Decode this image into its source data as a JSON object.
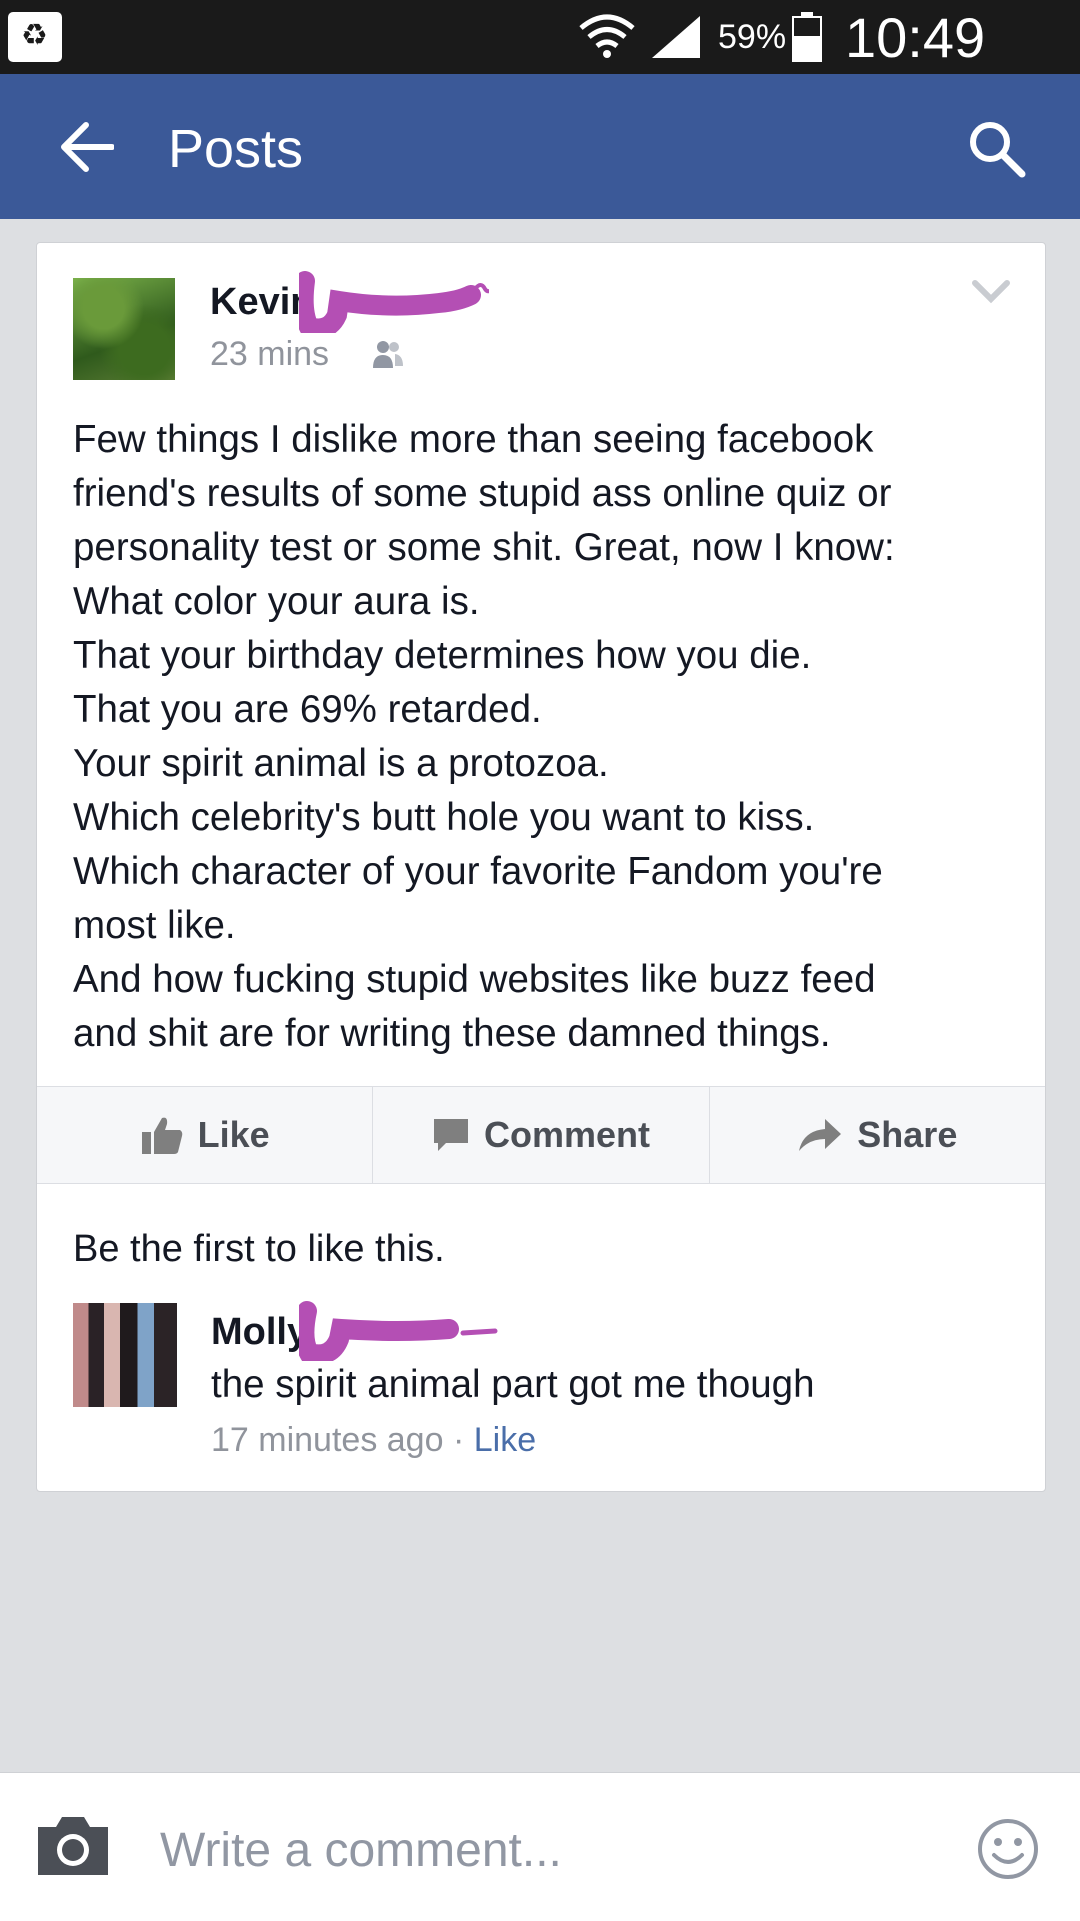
{
  "status_bar": {
    "battery_percent": "59%",
    "time": "10:49 PM"
  },
  "app_bar": {
    "title": "Posts"
  },
  "post": {
    "author": "Kevin",
    "time": "23 mins",
    "body_lines": [
      "Few things I dislike  more than seeing  facebook",
      "friend's results of some stupid ass online quiz or",
      "personality test or some shit. Great, now I know:",
      "What color your aura is.",
      "That your birthday determines how you die.",
      "That you are 69% retarded.",
      "Your spirit animal is a protozoa.",
      "Which celebrity's butt hole you want to kiss.",
      "Which character of your favorite Fandom you're",
      "most like.",
      "And how fucking stupid websites like buzz feed",
      "and shit are for writing these damned things."
    ],
    "actions": {
      "like": "Like",
      "comment": "Comment",
      "share": "Share"
    },
    "likes_summary": "Be the first to like this."
  },
  "comment": {
    "author": "Molly",
    "text": "the spirit animal part got me though",
    "time": "17 minutes ago",
    "separator": "·",
    "like_label": "Like"
  },
  "composer": {
    "placeholder": "Write a comment..."
  },
  "colors": {
    "app_bar": "#3b5998",
    "redaction": "#b44fb4",
    "link": "#4a6ea9"
  }
}
